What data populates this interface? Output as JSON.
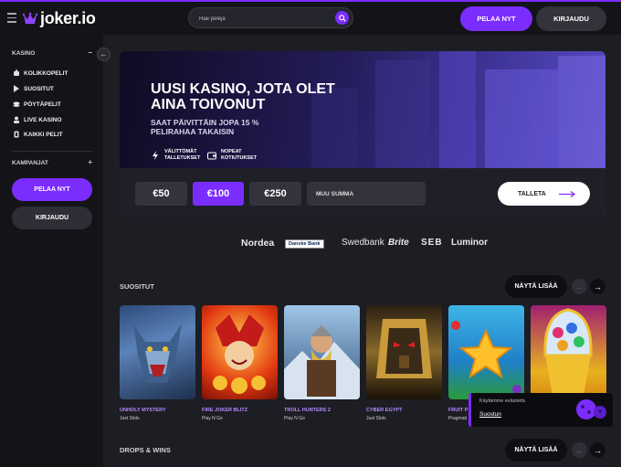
{
  "header": {
    "logo": "joker.io",
    "search_placeholder": "Hae pelejä",
    "play_label": "PELAA NYT",
    "login_label": "KIRJAUDU"
  },
  "sidebar": {
    "casino_title": "KASINO",
    "casino_toggle": "−",
    "items": [
      {
        "label": "KOLIKKOPELIT",
        "icon": "slot-icon"
      },
      {
        "label": "SUOSITUT",
        "icon": "play-icon"
      },
      {
        "label": "PÖYTÄPELIT",
        "icon": "chips-icon"
      },
      {
        "label": "LIVE KASINO",
        "icon": "dealer-icon"
      },
      {
        "label": "KAIKKI PELIT",
        "icon": "cards-icon"
      }
    ],
    "campaigns_title": "KAMPANJAT",
    "campaigns_toggle": "+",
    "play_label": "PELAA NYT",
    "login_label": "KIRJAUDU"
  },
  "hero": {
    "title": "UUSI KASINO, JOTA OLET AINA TOIVONUT",
    "subtitle": "SAAT PÄIVITTÄIN JOPA 15 % PELIRAHAA TAKAISIN",
    "feature1": "VÄLITTÖMÄT TALLETUKSET",
    "feature2": "NOPEAT KOTIUTUKSET",
    "amounts": [
      "€50",
      "€100",
      "€250"
    ],
    "selected_amount": "€100",
    "custom_amount": "MUU SUMMA",
    "deposit_label": "TALLETA"
  },
  "banks": [
    "Nordea",
    "Danske Bank",
    "Swedbank",
    "Brite",
    "SEB",
    "Luminor"
  ],
  "popular": {
    "title": "SUOSITUT",
    "more_label": "NÄYTÄ LISÄÄ",
    "games": [
      {
        "name": "UNHOLY MYSTERY",
        "provider": "Just Slots"
      },
      {
        "name": "FIRE JOKER BLITZ",
        "provider": "Play N Go"
      },
      {
        "name": "TROLL HUNTERS 2",
        "provider": "Play N Go"
      },
      {
        "name": "CYBER EGYPT",
        "provider": "Just Slots"
      },
      {
        "name": "FRUIT P",
        "provider": "Pragmati"
      },
      {
        "name": "",
        "provider": ""
      }
    ]
  },
  "drops": {
    "title": "DROPS & WINS",
    "more_label": "NÄYTÄ LISÄÄ"
  },
  "cookie": {
    "text": "Käytämme evästeitä",
    "accept_label": "Suostun"
  },
  "colors": {
    "accent": "#7b2dff",
    "background": "#1d1d24",
    "sidebar": "#141418"
  }
}
